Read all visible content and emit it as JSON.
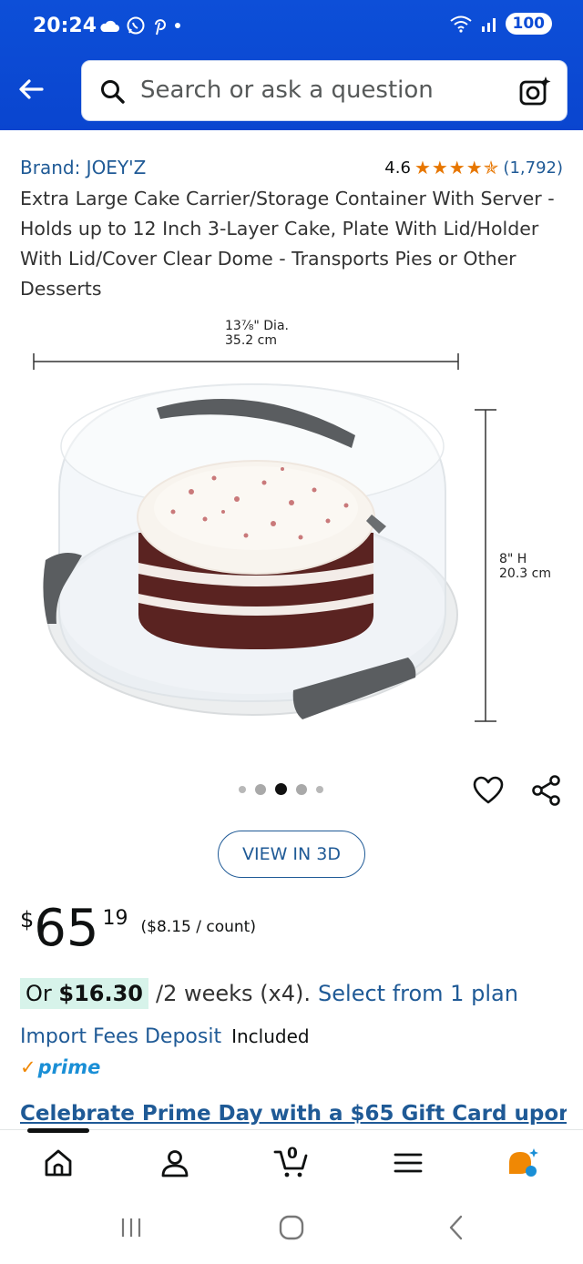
{
  "status_bar": {
    "time": "20:24",
    "battery": "100"
  },
  "search": {
    "placeholder": "Search or ask a question"
  },
  "product": {
    "brand": "Brand: JOEY'Z",
    "rating_value": "4.6",
    "stars": "★★★★✯",
    "rating_count": "(1,792)",
    "title": "Extra Large Cake Carrier/Storage Container With Server - Holds up to 12 Inch 3-Layer Cake, Plate With Lid/Holder With Lid/Cover Clear Dome - Transports Pies or Other Desserts"
  },
  "image": {
    "dia_label_1": "13⅞\" Dia.",
    "dia_label_2": "35.2 cm",
    "height_label_1": "8\" H",
    "height_label_2": "20.3 cm",
    "carousel_total": 5,
    "carousel_active": 3
  },
  "view3d_label": "VIEW IN 3D",
  "price": {
    "symbol": "$",
    "whole": "65",
    "fraction": "19",
    "unit_price": "($8.15 / count)"
  },
  "installment": {
    "prefix": "Or ",
    "amount": "$16.30",
    "term": "/2 weeks (x4).",
    "link": "Select from 1 plan"
  },
  "import": {
    "link": "Import Fees Deposit",
    "status": "Included"
  },
  "prime": {
    "check": "✓",
    "label": "prime"
  },
  "promo": "Celebrate Prime Day with a $65 Gift Card upon",
  "cart_count": "0",
  "colors": {
    "header_blue": "#0b4bd6",
    "link_blue": "#1f5a96",
    "star_orange": "#e77600",
    "installment_bg": "#d7f3ea"
  }
}
